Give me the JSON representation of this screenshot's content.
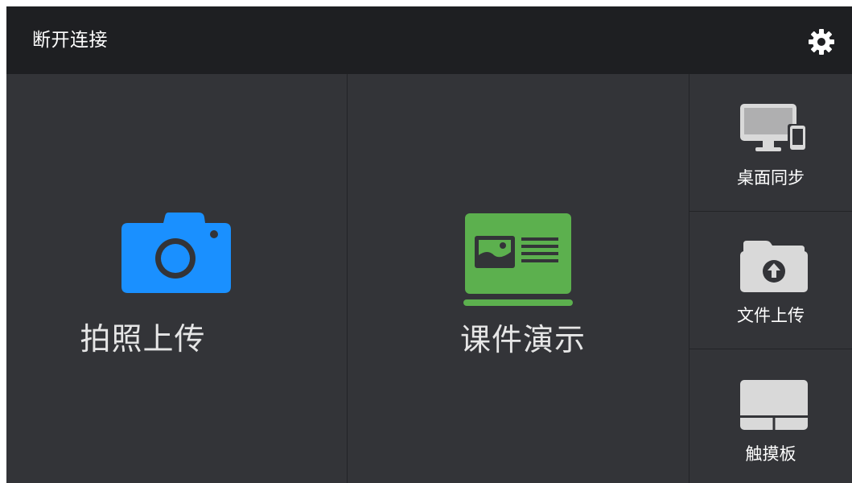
{
  "topbar": {
    "disconnect_label": "断开连接",
    "settings_icon": "gear-icon"
  },
  "main": {
    "photo_upload": {
      "label": "拍照上传",
      "icon": "camera-icon",
      "color": "#1a90ff"
    },
    "slides": {
      "label": "课件演示",
      "icon": "presentation-icon",
      "color": "#5cb04e"
    }
  },
  "side": {
    "items": [
      {
        "label": "桌面同步",
        "icon": "desktop-phone-icon"
      },
      {
        "label": "文件上传",
        "icon": "folder-upload-icon"
      },
      {
        "label": "触摸板",
        "icon": "touchpad-icon"
      }
    ]
  },
  "colors": {
    "background": "#2f3034",
    "topbar": "#1e1f22",
    "icon_gray": "#d9d9d9"
  }
}
